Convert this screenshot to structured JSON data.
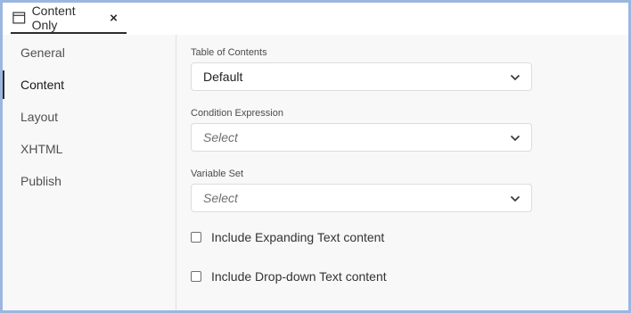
{
  "tab": {
    "title": "Content Only",
    "icon": "window-icon",
    "close_icon": "close-icon"
  },
  "sidebar": {
    "items": [
      {
        "label": "General",
        "active": false
      },
      {
        "label": "Content",
        "active": true
      },
      {
        "label": "Layout",
        "active": false
      },
      {
        "label": "XHTML",
        "active": false
      },
      {
        "label": "Publish",
        "active": false
      }
    ]
  },
  "content": {
    "toc": {
      "label": "Table of Contents",
      "value": "Default"
    },
    "condition": {
      "label": "Condition Expression",
      "placeholder": "Select"
    },
    "variable_set": {
      "label": "Variable Set",
      "placeholder": "Select"
    },
    "checkboxes": [
      {
        "label": "Include Expanding Text content",
        "checked": false
      },
      {
        "label": "Include Drop-down Text content",
        "checked": false
      }
    ]
  },
  "colors": {
    "frame_border": "#9bb7e0",
    "panel_bg": "#f8f8f8",
    "active_indicator": "#2c2c2c"
  }
}
